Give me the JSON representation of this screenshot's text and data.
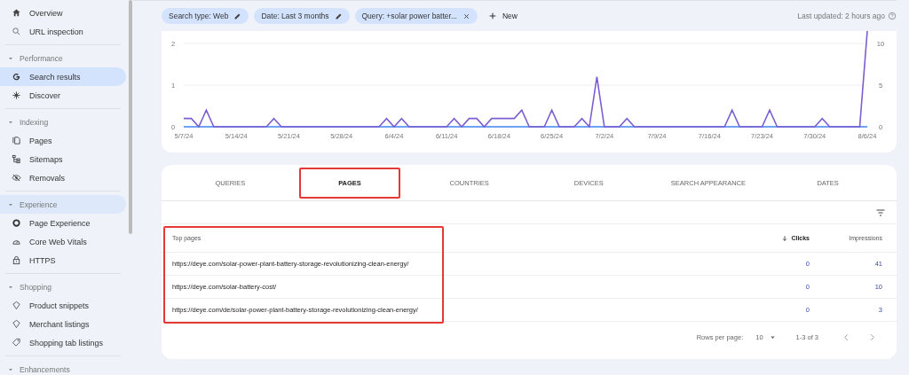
{
  "sidebar": {
    "items": [
      {
        "kind": "item",
        "label": "Overview",
        "selected": false
      },
      {
        "kind": "item",
        "label": "URL inspection",
        "selected": false
      },
      {
        "kind": "divider"
      },
      {
        "kind": "section",
        "label": "Performance",
        "expanded": true,
        "selected": false
      },
      {
        "kind": "item",
        "label": "Search results",
        "selected": true
      },
      {
        "kind": "item",
        "label": "Discover",
        "selected": false
      },
      {
        "kind": "divider"
      },
      {
        "kind": "section",
        "label": "Indexing",
        "expanded": true,
        "selected": false
      },
      {
        "kind": "item",
        "label": "Pages",
        "selected": false
      },
      {
        "kind": "item",
        "label": "Sitemaps",
        "selected": false
      },
      {
        "kind": "item",
        "label": "Removals",
        "selected": false
      },
      {
        "kind": "divider"
      },
      {
        "kind": "section",
        "label": "Experience",
        "expanded": true,
        "selected": true
      },
      {
        "kind": "item",
        "label": "Page Experience",
        "selected": false
      },
      {
        "kind": "item",
        "label": "Core Web Vitals",
        "selected": false
      },
      {
        "kind": "item",
        "label": "HTTPS",
        "selected": false
      },
      {
        "kind": "divider"
      },
      {
        "kind": "section",
        "label": "Shopping",
        "expanded": true,
        "selected": false
      },
      {
        "kind": "item",
        "label": "Product snippets",
        "selected": false
      },
      {
        "kind": "item",
        "label": "Merchant listings",
        "selected": false
      },
      {
        "kind": "item",
        "label": "Shopping tab listings",
        "selected": false
      },
      {
        "kind": "divider"
      },
      {
        "kind": "section",
        "label": "Enhancements",
        "expanded": true,
        "selected": false
      }
    ]
  },
  "filters": {
    "chips": [
      {
        "label": "Search type: Web",
        "kind": "editable"
      },
      {
        "label": "Date: Last 3 months",
        "kind": "editable"
      },
      {
        "label": "Query: +solar power batter...",
        "kind": "removable"
      }
    ],
    "new_button": "New",
    "last_updated": "Last updated: 2 hours ago"
  },
  "chart": {
    "left_axis_labels": [
      "2",
      "1",
      "0"
    ],
    "chart_data": {
      "type": "line",
      "categories": [
        "5/7/24",
        null,
        null,
        null,
        null,
        null,
        null,
        "5/14/24",
        null,
        null,
        null,
        null,
        null,
        null,
        "5/21/24",
        null,
        null,
        null,
        null,
        null,
        null,
        "5/28/24",
        null,
        null,
        null,
        null,
        null,
        null,
        "6/4/24",
        null,
        null,
        null,
        null,
        null,
        null,
        "6/11/24",
        null,
        null,
        null,
        null,
        null,
        null,
        "6/18/24",
        null,
        null,
        null,
        null,
        null,
        null,
        "6/25/24",
        null,
        null,
        null,
        null,
        null,
        null,
        "7/2/24",
        null,
        null,
        null,
        null,
        null,
        null,
        "7/9/24",
        null,
        null,
        null,
        null,
        null,
        null,
        "7/16/24",
        null,
        null,
        null,
        null,
        null,
        null,
        "7/23/24",
        null,
        null,
        null,
        null,
        null,
        null,
        "7/30/24",
        null,
        null,
        null,
        null,
        null,
        null,
        "8/6/24"
      ],
      "ylim": [
        0,
        11.5
      ],
      "yticks": [
        0,
        5,
        10
      ],
      "series": [
        {
          "color": "#4285f4",
          "values": [
            0,
            0,
            0,
            0,
            0,
            0,
            0,
            0,
            0,
            0,
            0,
            0,
            0,
            0,
            0,
            0,
            0,
            0,
            0,
            0,
            0,
            0,
            0,
            0,
            0,
            0,
            0,
            0,
            0,
            0,
            0,
            0,
            0,
            0,
            0,
            0,
            0,
            0,
            0,
            0,
            0,
            0,
            0,
            0,
            0,
            0,
            0,
            0,
            0,
            0,
            0,
            0,
            0,
            0,
            0,
            0,
            0,
            0,
            0,
            0,
            0,
            0,
            0,
            0,
            0,
            0,
            0,
            0,
            0,
            0,
            0,
            0,
            0,
            0,
            0,
            0,
            0,
            0,
            0,
            0,
            0,
            0,
            0,
            0,
            0,
            0,
            0,
            0,
            0,
            0,
            0,
            0
          ]
        },
        {
          "color": "#7b5ecf",
          "values": [
            1,
            1,
            0,
            2,
            0,
            0,
            0,
            0,
            0,
            0,
            0,
            0,
            1,
            0,
            0,
            0,
            0,
            0,
            0,
            0,
            0,
            0,
            0,
            0,
            0,
            0,
            0,
            1,
            0,
            1,
            0,
            0,
            0,
            0,
            0,
            0,
            1,
            0,
            1,
            1,
            0,
            1,
            1,
            1,
            1,
            2,
            0,
            0,
            0,
            2,
            0,
            0,
            0,
            1,
            0,
            6,
            0,
            0,
            0,
            1,
            0,
            0,
            0,
            0,
            0,
            0,
            0,
            0,
            0,
            0,
            0,
            0,
            0,
            2,
            0,
            0,
            0,
            0,
            2,
            0,
            0,
            0,
            0,
            0,
            0,
            1,
            0,
            0,
            0,
            0,
            0,
            11.5
          ]
        }
      ]
    }
  },
  "tabs": [
    {
      "label": "QUERIES",
      "selected": false,
      "highlighted": false
    },
    {
      "label": "PAGES",
      "selected": true,
      "highlighted": true
    },
    {
      "label": "COUNTRIES",
      "selected": false,
      "highlighted": false
    },
    {
      "label": "DEVICES",
      "selected": false,
      "highlighted": false
    },
    {
      "label": "SEARCH APPEARANCE",
      "selected": false,
      "highlighted": false
    },
    {
      "label": "DATES",
      "selected": false,
      "highlighted": false
    }
  ],
  "table": {
    "first_column_highlighted": true,
    "columns": [
      {
        "label": "Top pages",
        "sorted": false
      },
      {
        "label": "Clicks",
        "sorted": true
      },
      {
        "label": "Impressions",
        "sorted": false
      }
    ],
    "rows": [
      [
        "https://deye.com/solar-power-plant-battery-storage-revolutionizing-clean-energy/",
        "0",
        "41"
      ],
      [
        "https://deye.com/solar-battery-cost/",
        "0",
        "10"
      ],
      [
        "https://deye.com/de/solar-power-plant-battery-storage-revolutionizing-clean-energy/",
        "0",
        "3"
      ]
    ],
    "footer": {
      "rows_per_page_label": "Rows per page:",
      "rows_per_page": "10",
      "range": "1-3 of 3"
    }
  }
}
